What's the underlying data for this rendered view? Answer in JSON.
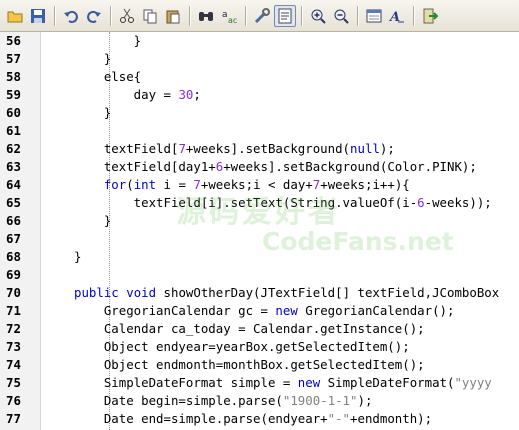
{
  "toolbar": {
    "buttons": [
      "open-folder-icon",
      "save-icon",
      "undo-icon",
      "redo-icon",
      "cut-icon",
      "copy-icon",
      "paste-icon",
      "find-icon",
      "replace-icon",
      "tools-icon",
      "document-icon",
      "zoom-in-icon",
      "zoom-out-icon",
      "page-icon",
      "font-icon",
      "exit-icon"
    ]
  },
  "watermark": {
    "cn": "源码爱好者",
    "en": "CodeFans.net"
  },
  "editor": {
    "lines": [
      {
        "n": "56",
        "segs": [
          {
            "t": "        }"
          }
        ]
      },
      {
        "n": "57",
        "segs": [
          {
            "t": "    }"
          }
        ]
      },
      {
        "n": "58",
        "segs": [
          {
            "t": "    else{"
          }
        ]
      },
      {
        "n": "59",
        "segs": [
          {
            "t": "        day = "
          },
          {
            "t": "30",
            "c": "num"
          },
          {
            "t": ";"
          }
        ]
      },
      {
        "n": "60",
        "segs": [
          {
            "t": "    }"
          }
        ]
      },
      {
        "n": "61",
        "segs": [
          {
            "t": ""
          }
        ]
      },
      {
        "n": "62",
        "segs": [
          {
            "t": "    textField["
          },
          {
            "t": "7",
            "c": "num"
          },
          {
            "t": "+weeks].setBackground("
          },
          {
            "t": "null",
            "c": "kw"
          },
          {
            "t": ");"
          }
        ]
      },
      {
        "n": "63",
        "segs": [
          {
            "t": "    textField[day1+"
          },
          {
            "t": "6",
            "c": "num"
          },
          {
            "t": "+weeks].setBackground(Color.PINK);"
          }
        ]
      },
      {
        "n": "64",
        "segs": [
          {
            "t": "    "
          },
          {
            "t": "for",
            "c": "kw"
          },
          {
            "t": "("
          },
          {
            "t": "int",
            "c": "kw"
          },
          {
            "t": " i = "
          },
          {
            "t": "7",
            "c": "num"
          },
          {
            "t": "+weeks;i < day+"
          },
          {
            "t": "7",
            "c": "num"
          },
          {
            "t": "+weeks;i++){"
          }
        ]
      },
      {
        "n": "65",
        "segs": [
          {
            "t": "        textField[i].setText(String.valueOf(i-"
          },
          {
            "t": "6",
            "c": "num"
          },
          {
            "t": "-weeks));"
          }
        ]
      },
      {
        "n": "66",
        "segs": [
          {
            "t": "    }"
          }
        ]
      },
      {
        "n": "67",
        "segs": [
          {
            "t": ""
          }
        ]
      },
      {
        "n": "68",
        "segs": [
          {
            "t": "}"
          }
        ]
      },
      {
        "n": "69",
        "segs": [
          {
            "t": ""
          }
        ]
      },
      {
        "n": "70",
        "segs": [
          {
            "t": "public",
            "c": "kw"
          },
          {
            "t": " "
          },
          {
            "t": "void",
            "c": "kw"
          },
          {
            "t": " showOtherDay(JTextField[] textField,JComboBox"
          }
        ]
      },
      {
        "n": "71",
        "segs": [
          {
            "t": "    GregorianCalendar gc = "
          },
          {
            "t": "new",
            "c": "kw"
          },
          {
            "t": " GregorianCalendar();"
          }
        ]
      },
      {
        "n": "72",
        "segs": [
          {
            "t": "    Calendar ca_today = Calendar.getInstance();"
          }
        ]
      },
      {
        "n": "73",
        "segs": [
          {
            "t": "    Object endyear=yearBox.getSelectedItem();"
          }
        ]
      },
      {
        "n": "74",
        "segs": [
          {
            "t": "    Object endmonth=monthBox.getSelectedItem();"
          }
        ]
      },
      {
        "n": "75",
        "segs": [
          {
            "t": "    SimpleDateFormat simple = "
          },
          {
            "t": "new",
            "c": "kw"
          },
          {
            "t": " SimpleDateFormat("
          },
          {
            "t": "\"yyyy",
            "c": "str"
          }
        ]
      },
      {
        "n": "76",
        "segs": [
          {
            "t": "    Date begin=simple.parse("
          },
          {
            "t": "\"1900-1-1\"",
            "c": "str"
          },
          {
            "t": ");"
          }
        ]
      },
      {
        "n": "77",
        "segs": [
          {
            "t": "    Date end=simple.parse(endyear+"
          },
          {
            "t": "\"-\"",
            "c": "str"
          },
          {
            "t": "+endmonth);"
          }
        ]
      }
    ]
  }
}
